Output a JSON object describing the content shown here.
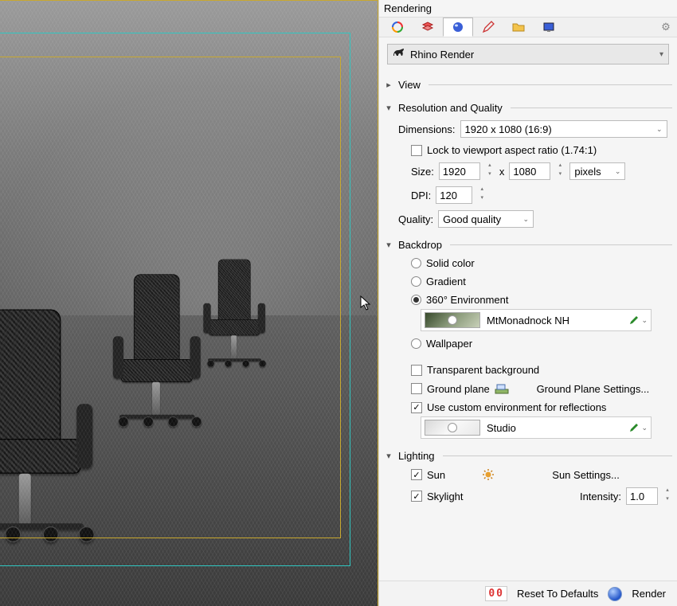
{
  "panel": {
    "title": "Rendering"
  },
  "renderer": {
    "selected": "Rhino Render"
  },
  "sections": {
    "view": {
      "label": "View",
      "expanded": false
    },
    "resolution": {
      "label": "Resolution and Quality",
      "dimensions_label": "Dimensions:",
      "dimensions_value": "1920 x 1080 (16:9)",
      "lock_label": "Lock to viewport aspect ratio (1.74:1)",
      "lock_checked": false,
      "size_label": "Size:",
      "size_w": "1920",
      "size_x": "x",
      "size_h": "1080",
      "units": "pixels",
      "dpi_label": "DPI:",
      "dpi_value": "120",
      "quality_label": "Quality:",
      "quality_value": "Good quality"
    },
    "backdrop": {
      "label": "Backdrop",
      "solid": "Solid color",
      "gradient": "Gradient",
      "env360": "360° Environment",
      "env_name": "MtMonadnock NH",
      "wallpaper": "Wallpaper",
      "selected": "env360",
      "transparent_label": "Transparent background",
      "transparent_checked": false,
      "groundplane_label": "Ground plane",
      "groundplane_checked": false,
      "groundplane_settings": "Ground Plane Settings...",
      "custom_env_label": "Use custom environment for reflections",
      "custom_env_checked": true,
      "custom_env_name": "Studio"
    },
    "lighting": {
      "label": "Lighting",
      "sun_label": "Sun",
      "sun_checked": true,
      "sun_settings": "Sun Settings...",
      "skylight_label": "Skylight",
      "skylight_checked": true,
      "intensity_label": "Intensity:",
      "intensity_value": "1.0"
    }
  },
  "footer": {
    "counter": "00",
    "reset": "Reset To Defaults",
    "render": "Render"
  }
}
